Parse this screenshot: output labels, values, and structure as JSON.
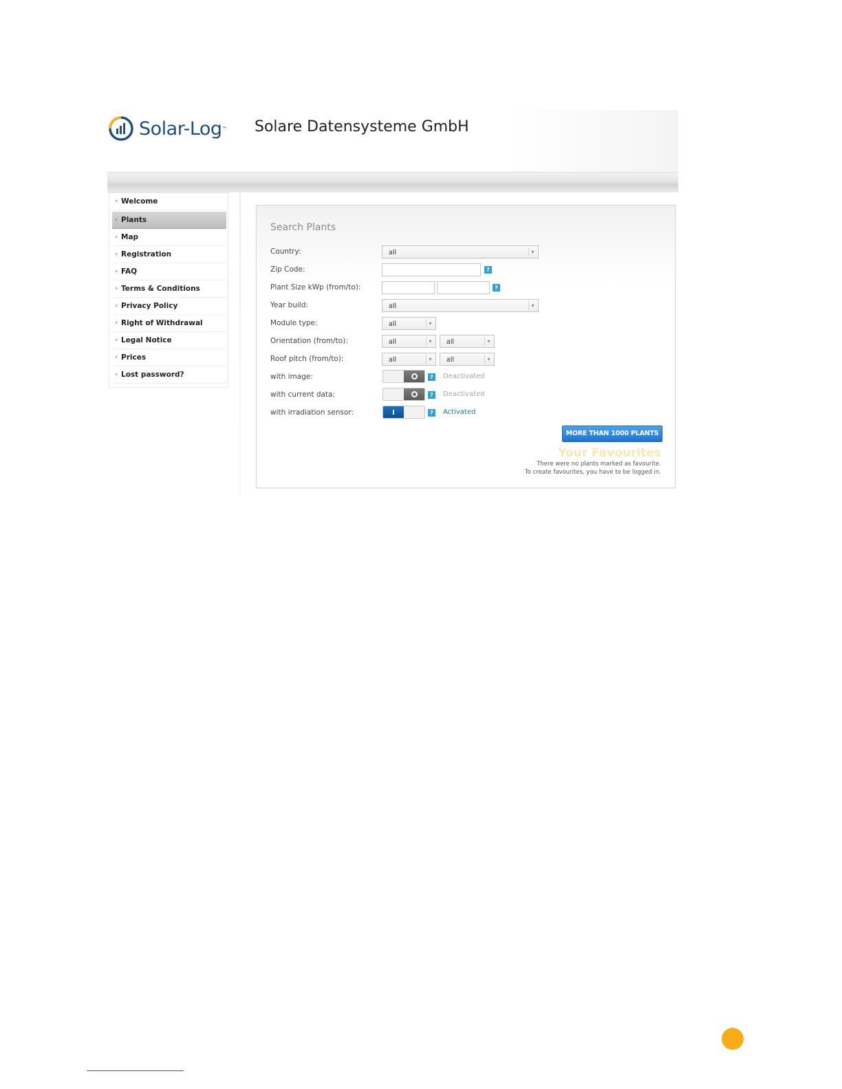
{
  "header": {
    "logo_text": "Solar-Log",
    "logo_tm": "™",
    "company": "Solare Datensysteme GmbH"
  },
  "sidebar": {
    "items": [
      {
        "label": "Welcome",
        "active": false
      },
      {
        "label": "Plants",
        "active": true
      },
      {
        "label": "Map",
        "active": false
      },
      {
        "label": "Registration",
        "active": false
      },
      {
        "label": "FAQ",
        "active": false
      },
      {
        "label": "Terms & Conditions",
        "active": false
      },
      {
        "label": "Privacy Policy",
        "active": false
      },
      {
        "label": "Right of Withdrawal",
        "active": false
      },
      {
        "label": "Legal Notice",
        "active": false
      },
      {
        "label": "Prices",
        "active": false
      },
      {
        "label": "Lost password?",
        "active": false
      }
    ]
  },
  "search": {
    "title": "Search Plants",
    "country_label": "Country:",
    "country_value": "all",
    "zip_label": "Zip Code:",
    "plant_size_label": "Plant Size kWp (from/to):",
    "year_label": "Year build:",
    "year_value": "all",
    "module_label": "Module type:",
    "module_value": "all",
    "orientation_label": "Orientation (from/to):",
    "orientation_from": "all",
    "orientation_to": "all",
    "roof_label": "Roof pitch (from/to):",
    "roof_from": "all",
    "roof_to": "all",
    "help_glyph": "?",
    "with_image_label": "with image:",
    "with_image_status": "Deactivated",
    "with_current_label": "with current data:",
    "with_current_status": "Deactivated",
    "with_irradiation_label": "with irradiation sensor:",
    "with_irradiation_status": "Activated",
    "more_button": "MORE THAN 1000 PLANTS"
  },
  "favourites": {
    "title": "Your Favourites",
    "note_1": "There were no plants marked as favourite.",
    "note_2": "To create favourites, you have to be logged in."
  },
  "colors": {
    "brand_blue": "#1d4f86",
    "accent_orange": "#f8ad18",
    "button_blue": "#1d73d0",
    "help_blue": "#2da2d8"
  },
  "icons": {
    "chevron": "chevron-down-icon",
    "sidebar_arrow": "chevron-right-icon",
    "help": "help-icon"
  }
}
